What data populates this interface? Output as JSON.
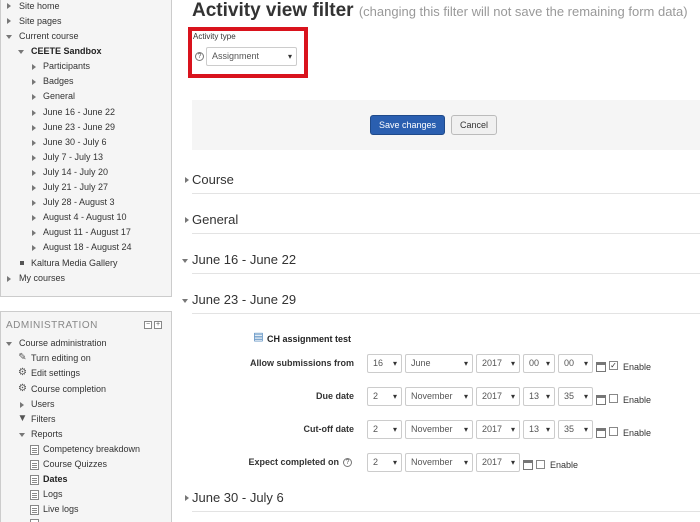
{
  "nav": {
    "items": [
      "Site home",
      "Site pages",
      "Current course",
      "CEETE Sandbox",
      "Participants",
      "Badges",
      "General",
      "June 16 - June 22",
      "June 23 - June 29",
      "June 30 - July 6",
      "July 7 - July 13",
      "July 14 - July 20",
      "July 21 - July 27",
      "July 28 - August 3",
      "August 4 - August 10",
      "August 11 - August 17",
      "August 18 - August 24",
      "Kaltura Media Gallery",
      "My courses"
    ]
  },
  "admin": {
    "title": "ADMINISTRATION",
    "items": [
      "Course administration",
      "Turn editing on",
      "Edit settings",
      "Course completion",
      "Users",
      "Filters",
      "Reports",
      "Competency breakdown",
      "Course Quizzes",
      "Dates",
      "Logs",
      "Live logs"
    ]
  },
  "page": {
    "title": "Activity view filter",
    "subtitle": "(changing this filter will not save the remaining form data)"
  },
  "filter": {
    "label": "Activity type",
    "value": "Assignment"
  },
  "buttons": {
    "save": "Save changes",
    "cancel": "Cancel"
  },
  "sections": [
    "Course",
    "General",
    "June 16 - June 22",
    "June 23 - June 29",
    "June 30 - July 6"
  ],
  "activity": {
    "name": "CH assignment test",
    "enable_label": "Enable",
    "rows": [
      {
        "label": "Allow submissions from",
        "day": "16",
        "month": "June",
        "year": "2017",
        "hour": "00",
        "minute": "00",
        "enabled": "✓"
      },
      {
        "label": "Due date",
        "day": "2",
        "month": "November",
        "year": "2017",
        "hour": "13",
        "minute": "35",
        "enabled": ""
      },
      {
        "label": "Cut-off date",
        "day": "2",
        "month": "November",
        "year": "2017",
        "hour": "13",
        "minute": "35",
        "enabled": ""
      },
      {
        "label": "Expect completed on",
        "day": "2",
        "month": "November",
        "year": "2017",
        "enabled": ""
      }
    ]
  }
}
